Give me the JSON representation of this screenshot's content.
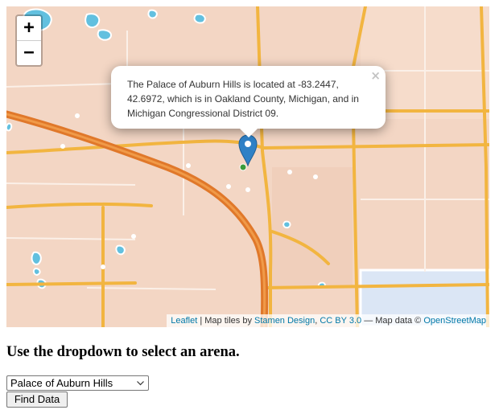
{
  "map": {
    "zoom_in_label": "+",
    "zoom_out_label": "−",
    "popup": {
      "text": "The Palace of Auburn Hills is located at -83.2447, 42.6972, which is in Oakland County, Michigan, and in Michigan Congressional District 09.",
      "close_label": "×"
    },
    "marker_icon": "map-pin-icon",
    "attribution": {
      "leaflet": "Leaflet",
      "sep1": " | Map tiles by ",
      "stamen": "Stamen Design",
      "sep2": ", ",
      "license": "CC BY 3.0",
      "sep3": " — Map data © ",
      "osm": "OpenStreetMap"
    },
    "colors": {
      "land": "#f3d6c4",
      "water": "#62c0df",
      "major_road": "#e0782a",
      "road": "#f2b540",
      "marker": "#2f81c6",
      "link": "#0078a8"
    }
  },
  "instruction": "Use the dropdown to select an arena.",
  "arena_select": {
    "selected": "Palace of Auburn Hills"
  },
  "find_button_label": "Find Data"
}
